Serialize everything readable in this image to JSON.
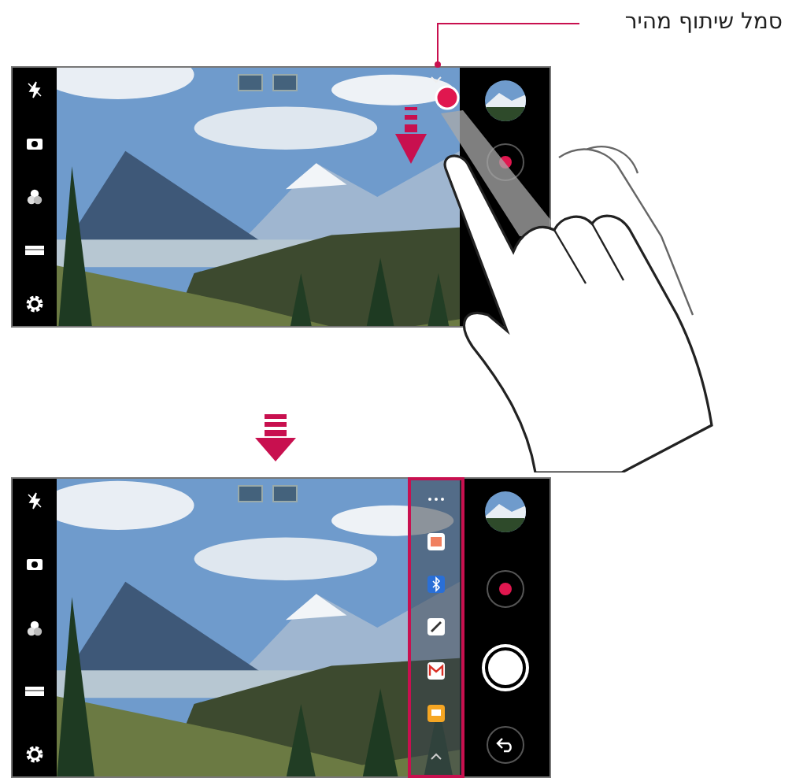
{
  "callout": {
    "label": "סמל שיתוף מהיר"
  },
  "screens": [
    {
      "share_panel_open": false
    },
    {
      "share_panel_open": true
    }
  ]
}
